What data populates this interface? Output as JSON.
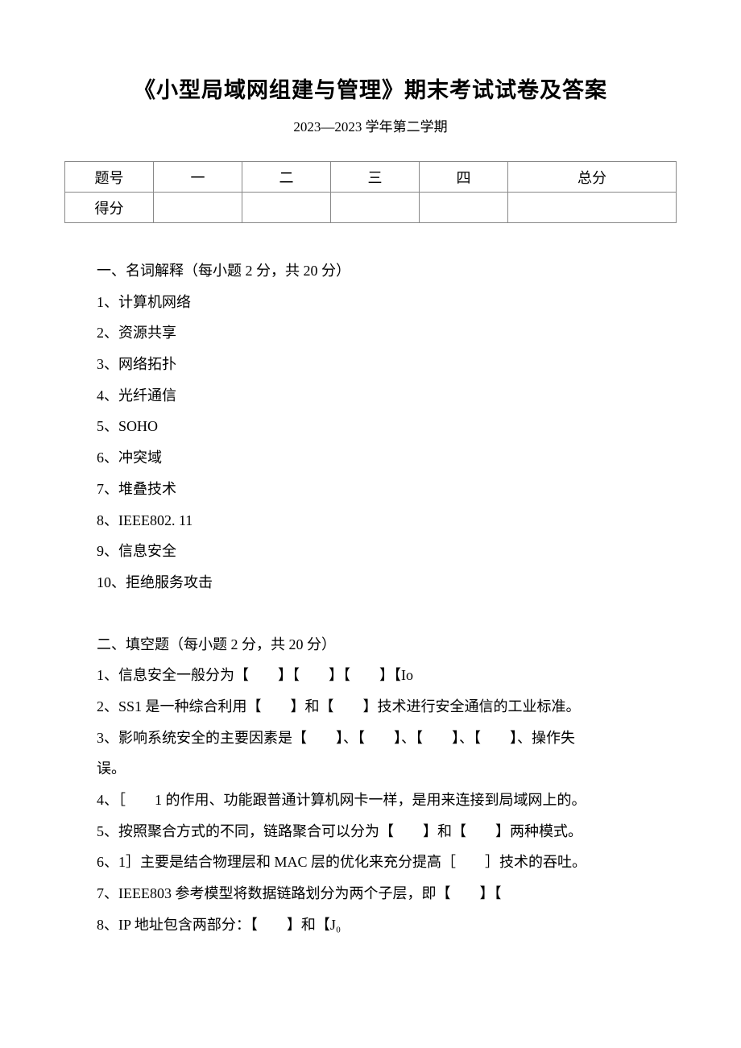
{
  "title": "《小型局域网组建与管理》期末考试试卷及答案",
  "subtitle": "2023—2023 学年第二学期",
  "table": {
    "row1": {
      "label": "题号",
      "c1": "一",
      "c2": "二",
      "c3": "三",
      "c4": "四",
      "total": "总分"
    },
    "row2": {
      "label": "得分",
      "c1": "",
      "c2": "",
      "c3": "",
      "c4": "",
      "total": ""
    }
  },
  "section1": {
    "heading": "一、名词解释（每小题 2 分，共 20 分）",
    "items": [
      "1、计算机网络",
      "2、资源共享",
      "3、网络拓扑",
      "4、光纤通信",
      "5、SOHO",
      "6、冲突域",
      "7、堆叠技术",
      "8、IEEE802. 11",
      "9、信息安全",
      "10、拒绝服务攻击"
    ]
  },
  "section2": {
    "heading": "二、填空题（每小题 2 分，共 20 分）",
    "items": [
      "1、信息安全一般分为【　　】【　　】【　　】【Io",
      "2、SS1 是一种综合利用【　　】和【　　】技术进行安全通信的工业标准。",
      "3、影响系统安全的主要因素是【　　】、【　　】、【　　】、【　　】、操作失",
      "4、［　　1 的作用、功能跟普通计算机网卡一样，是用来连接到局域网上的。",
      "5、按照聚合方式的不同，链路聚合可以分为【　　】和【　　】两种模式。",
      "6、1］主要是结合物理层和 MAC 层的优化来充分提高［　　］技术的吞吐。",
      "7、IEEE803 参考模型将数据链路划分为两个子层，即【　　】【",
      "8、IP 地址包含两部分：【　　】和【J₀"
    ],
    "wrap_end": "误。"
  }
}
